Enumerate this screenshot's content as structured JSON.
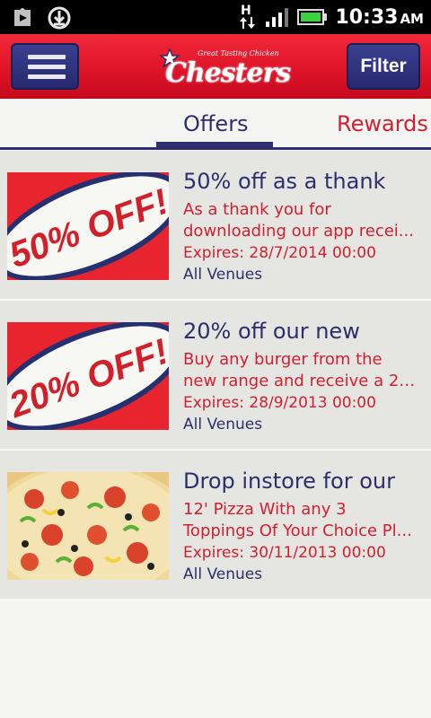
{
  "status_bar": {
    "time": "10:33",
    "ampm": "AM",
    "network": "H",
    "icons": [
      "play-store-icon",
      "download-icon",
      "network-h-icon",
      "signal-icon",
      "battery-icon"
    ]
  },
  "header": {
    "logo_tagline": "Great Tasting Chicken",
    "logo_text": "Chesters",
    "filter_label": "Filter",
    "menu_icon": "hamburger-menu-icon"
  },
  "tabs": {
    "offers": "Offers",
    "rewards": "Rewards",
    "active": "offers"
  },
  "offers": [
    {
      "title": "50% off as a thank",
      "desc_line1": "As a thank you for",
      "desc_line2": "downloading our app recei...",
      "expires": "Expires: 28/7/2014 00:00",
      "venue": "All Venues",
      "badge": "50% OFF!"
    },
    {
      "title": "20% off our new",
      "desc_line1": "Buy any burger from the",
      "desc_line2": "new range and receive a 20...",
      "expires": "Expires: 28/9/2013 00:00",
      "venue": "All Venues",
      "badge": "20% OFF!"
    },
    {
      "title": "Drop instore for our",
      "desc_line1": "12' Pizza With any 3",
      "desc_line2": "Toppings Of Your Choice Pl...",
      "expires": "Expires: 30/11/2013 00:00",
      "venue": "All Venues",
      "badge": ""
    }
  ],
  "colors": {
    "brand_red": "#e01428",
    "brand_navy": "#2e2e6e",
    "accent_red_text": "#d31f2f"
  }
}
